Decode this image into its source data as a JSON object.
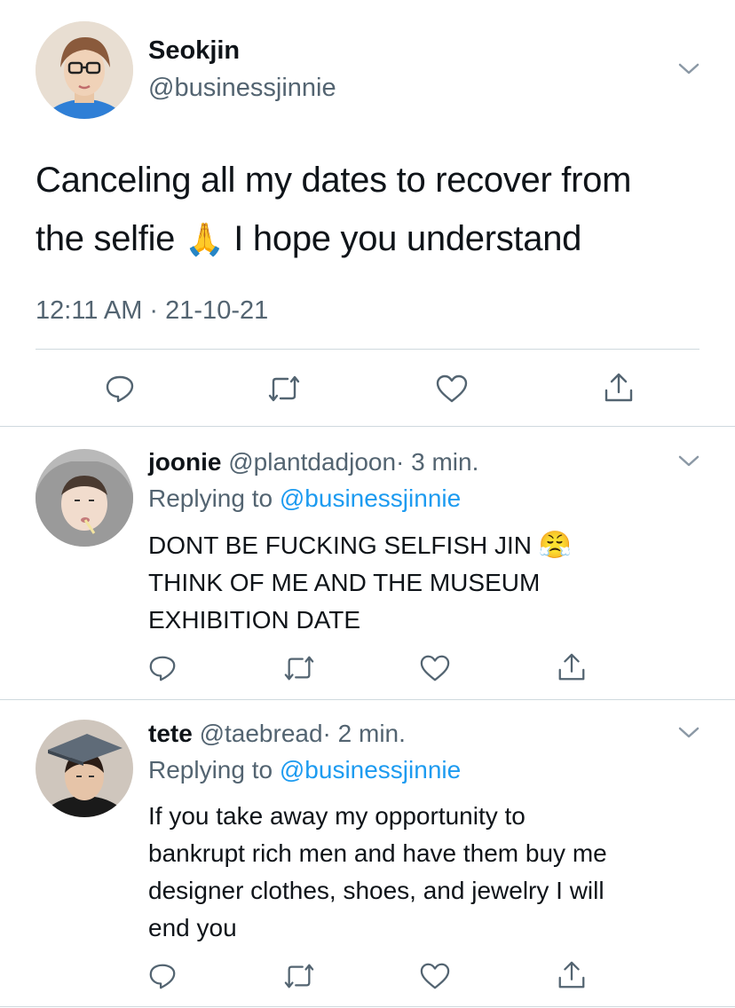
{
  "main_tweet": {
    "display_name": "Seokjin",
    "handle": "@businessjinnie",
    "text_line1": "Canceling all my dates to recover from",
    "text_line2_before": "the selfie",
    "emoji": "🙏",
    "text_line2_after": "I hope you understand",
    "timestamp": "12:11 AM · 21-10-21"
  },
  "replies": [
    {
      "display_name": "joonie",
      "handle": "@plantdadjoon",
      "time": "· 3 min.",
      "replying_prefix": "Replying to",
      "replying_handle": "@businessjinnie",
      "lines": [
        "DONT BE FUCKING SELFISH JIN",
        "THINK OF ME AND THE MUSEUM",
        "EXHIBITION DATE"
      ],
      "emoji": "😤"
    },
    {
      "display_name": "tete",
      "handle": "@taebread",
      "time": "· 2 min.",
      "replying_prefix": "Replying to",
      "replying_handle": "@businessjinnie",
      "lines": [
        "If you take away my opportunity to",
        "bankrupt rich men and have them buy me",
        "designer clothes, shoes, and jewelry I will",
        "end you"
      ]
    }
  ],
  "icons": [
    "reply-icon",
    "retweet-icon",
    "like-icon",
    "share-icon",
    "chevron-down-icon"
  ],
  "colors": {
    "text": "#0f1419",
    "muted": "#536471",
    "link": "#1d9bf0",
    "divider": "#cfd9de"
  }
}
